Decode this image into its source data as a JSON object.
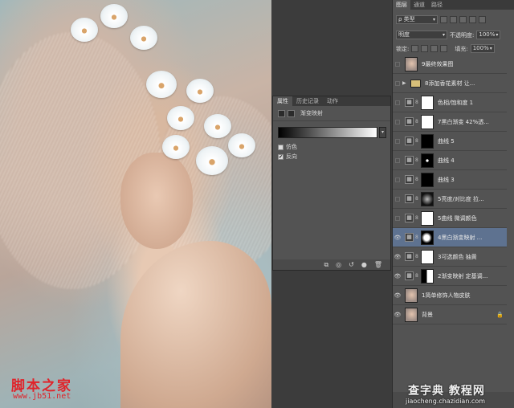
{
  "canvas": {
    "watermark_cn": "脚本之家",
    "watermark_url": "www.jb51.net"
  },
  "properties": {
    "tabs": [
      "属性",
      "历史记录",
      "动作"
    ],
    "title": "渐变映射",
    "dither_label": "仿色",
    "dither_checked": false,
    "reverse_label": "反向",
    "reverse_checked": true,
    "gradient_colors": [
      "#000000",
      "#ffffff"
    ]
  },
  "layers": {
    "tabs": [
      "图层",
      "通道",
      "路径"
    ],
    "filter_label": "ρ 类型",
    "blend_mode": "明度",
    "opacity_label": "不透明度:",
    "opacity_value": "100%",
    "lock_label": "锁定:",
    "fill_label": "填充:",
    "fill_value": "100%",
    "items": [
      {
        "name": "9最终效果图",
        "visible": false,
        "kind": "pixel"
      },
      {
        "name": "8添加香花素材 让...",
        "visible": false,
        "kind": "group"
      },
      {
        "name": "色相/饱和度 1",
        "visible": false,
        "kind": "adjust",
        "mask": "white"
      },
      {
        "name": "7黑白渐变 42%透...",
        "visible": false,
        "kind": "adjust",
        "mask": "white"
      },
      {
        "name": "曲线 5",
        "visible": false,
        "kind": "adjust",
        "mask": "black"
      },
      {
        "name": "曲线 4",
        "visible": false,
        "kind": "adjust",
        "mask": "spot"
      },
      {
        "name": "曲线 3",
        "visible": false,
        "kind": "adjust",
        "mask": "black"
      },
      {
        "name": "5亮度/对比度 拉...",
        "visible": false,
        "kind": "adjust",
        "mask": "soft"
      },
      {
        "name": "5曲线 微调颜色",
        "visible": false,
        "kind": "adjust",
        "mask": "white"
      },
      {
        "name": "4黑白渐变映射 ...",
        "visible": true,
        "kind": "adjust",
        "mask": "blob",
        "active": true
      },
      {
        "name": "3可选颜色 抽黄",
        "visible": true,
        "kind": "adjust",
        "mask": "white"
      },
      {
        "name": "2渐变映射 定基调...",
        "visible": true,
        "kind": "adjust",
        "mask": "split"
      },
      {
        "name": "1简单修饰人物皮肤",
        "visible": true,
        "kind": "pixel"
      },
      {
        "name": "背景",
        "visible": true,
        "kind": "pixel",
        "locked": true
      }
    ]
  },
  "brand": {
    "name": "查字典 教程网",
    "url": "jiaocheng.chazidian.com"
  }
}
